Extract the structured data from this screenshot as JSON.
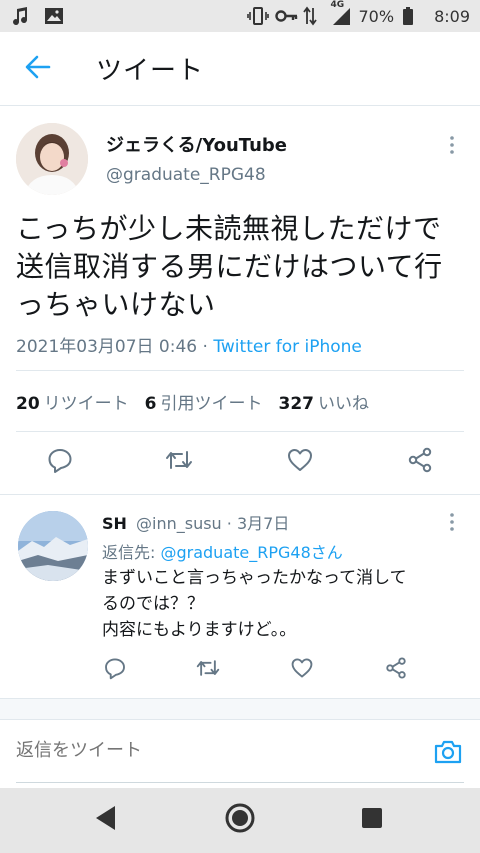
{
  "status_bar": {
    "icons_left": [
      "music-note-icon",
      "image-icon"
    ],
    "network_label": "4G",
    "battery": "70%",
    "time": "8:09"
  },
  "header": {
    "title": "ツイート"
  },
  "tweet": {
    "author_name": "ジェラくる/YouTube",
    "author_handle": "@graduate_RPG48",
    "text_lines": [
      "こっちが少し未読無視しただけで",
      "送信取消する男にだけはついて行",
      "っちゃいけない"
    ],
    "timestamp": "2021年03月07日 0:46",
    "separator": " · ",
    "client": "Twitter for iPhone",
    "stats": {
      "retweets_count": "20",
      "retweets_label": "リツイート",
      "quotes_count": "6",
      "quotes_label": "引用ツイート",
      "likes_count": "327",
      "likes_label": "いいね"
    }
  },
  "reply": {
    "author_name": "SH",
    "author_handle": "@inn_susu",
    "date": "· 3月7日",
    "reply_to_label": "返信先: ",
    "reply_to_handle": "@graduate_RPG48さん",
    "text_lines": [
      "まずいこと言っちゃったかなって消して",
      "るのでは？？",
      "内容にもよりますけど。。"
    ]
  },
  "compose": {
    "placeholder": "返信をツイート"
  },
  "colors": {
    "accent": "#1da1f2",
    "secondary_text": "#657786",
    "icon_gray": "#657786"
  }
}
